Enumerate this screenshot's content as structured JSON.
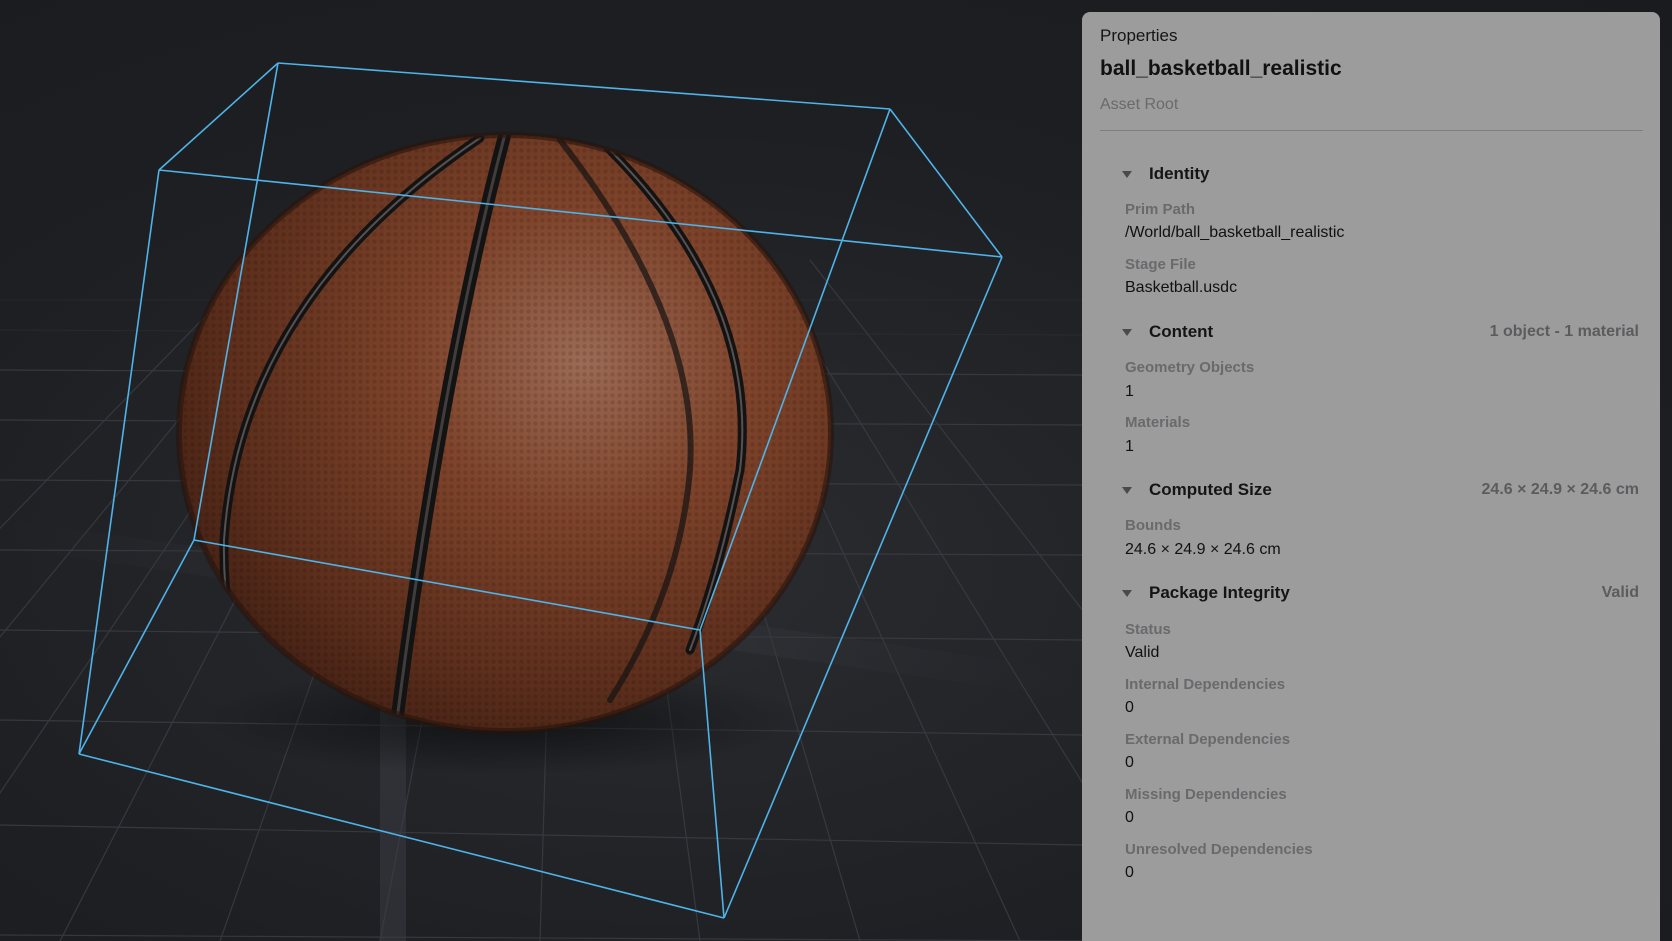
{
  "panel": {
    "header_label": "Properties",
    "asset_name": "ball_basketball_realistic",
    "asset_kind": "Asset Root"
  },
  "sections": {
    "identity": {
      "title": "Identity",
      "summary": "",
      "fields": [
        {
          "label": "Prim Path",
          "value": "/World/ball_basketball_realistic"
        },
        {
          "label": "Stage File",
          "value": "Basketball.usdc"
        }
      ]
    },
    "content": {
      "title": "Content",
      "summary": "1 object - 1 material",
      "fields": [
        {
          "label": "Geometry Objects",
          "value": "1"
        },
        {
          "label": "Materials",
          "value": "1"
        }
      ]
    },
    "computed_size": {
      "title": "Computed Size",
      "summary": "24.6 × 24.9 × 24.6 cm",
      "fields": [
        {
          "label": "Bounds",
          "value": "24.6 × 24.9 × 24.6 cm"
        }
      ]
    },
    "package_integrity": {
      "title": "Package Integrity",
      "summary": "Valid",
      "fields": [
        {
          "label": "Status",
          "value": "Valid"
        },
        {
          "label": "Internal Dependencies",
          "value": "0"
        },
        {
          "label": "External Dependencies",
          "value": "0"
        },
        {
          "label": "Missing Dependencies",
          "value": "0"
        },
        {
          "label": "Unresolved Dependencies",
          "value": "0"
        }
      ]
    }
  },
  "viewport": {
    "bounding_box_color": "#4fb3e8",
    "ball_color": "#7a4028",
    "seam_color": "#1b1a1a",
    "grid_color": "#3c3f44",
    "background_color": "#1e2024"
  }
}
